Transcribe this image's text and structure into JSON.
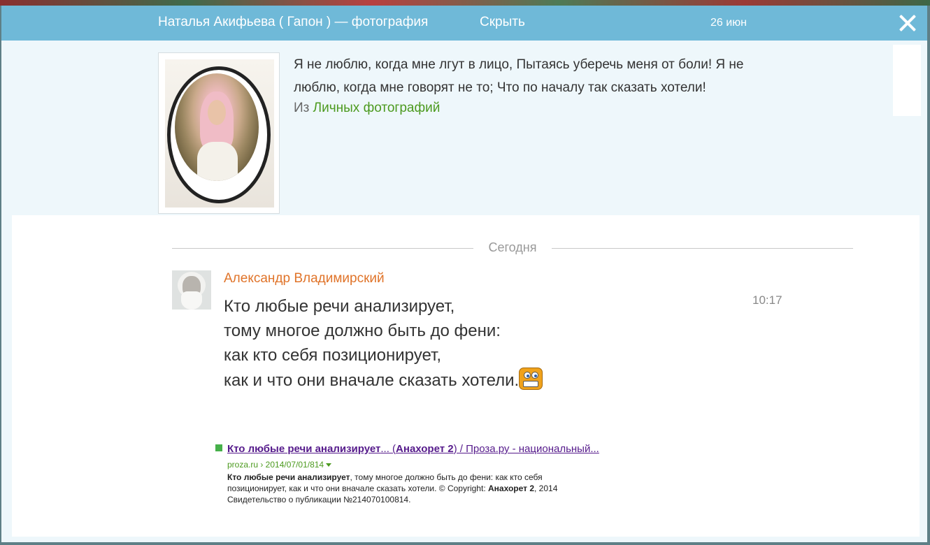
{
  "header": {
    "title": "Наталья Акифьева ( Гапон ) — фотография",
    "hide_label": "Скрыть",
    "date": "26 июн"
  },
  "post": {
    "text": "Я не люблю, когда мне лгут в лицо, Пытаясь уберечь меня от боли! Я не люблю, когда мне говорят не то; Что по началу так сказать хотели!",
    "from_prefix": "Из",
    "from_link": "Личных фотографий"
  },
  "comments": {
    "day_label": "Сегодня",
    "items": [
      {
        "author": "Александр Владимирский",
        "time": "10:17",
        "lines": [
          "Кто любые речи анализирует,",
          "тому многое должно быть до фени:",
          "как кто себя позиционирует,",
          "как и что они вначале сказать хотели."
        ],
        "emoji": "grinning-smiley-icon"
      }
    ]
  },
  "search_result": {
    "title_bold": "Кто любые речи анализирует",
    "title_mid": "... (",
    "title_bold2": "Анахорет 2",
    "title_tail": ") / Проза.ру - национальный...",
    "url": "proza.ru › 2014/07/01/814",
    "snippet_bold1": "Кто любые речи анализирует",
    "snippet_text1": ", тому многое должно быть до фени: как кто себя позиционирует, как и что они вначале сказать хотели. © Copyright: ",
    "snippet_bold2": "Анахорет 2",
    "snippet_text2": ", 2014 Свидетельство о публикации №214070100814."
  }
}
